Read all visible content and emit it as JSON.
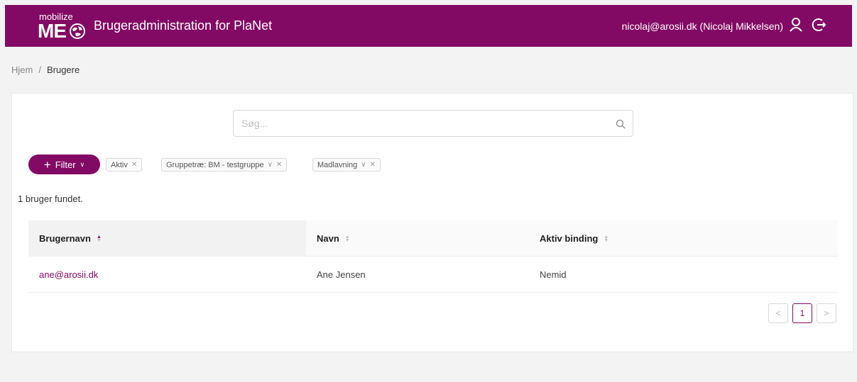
{
  "header": {
    "logo_small": "mobilize",
    "logo_big": "ME",
    "title": "Brugeradministration for PlaNet",
    "user": "nicolaj@arosii.dk (Nicolaj Mikkelsen)",
    "user_icon": "user-icon",
    "logout_icon": "logout-icon"
  },
  "breadcrumb": {
    "home": "Hjem",
    "separator": "/",
    "current": "Brugere"
  },
  "search": {
    "placeholder": "Søg...",
    "value": ""
  },
  "filters": {
    "button_label": "Filter",
    "tags": [
      {
        "label": "Aktiv"
      },
      {
        "label": "Gruppetræ: BM - testgruppe"
      },
      {
        "label": "Madlavning"
      }
    ]
  },
  "result_count": "1 bruger fundet.",
  "table": {
    "columns": [
      "Brugernavn",
      "Navn",
      "Aktiv binding"
    ],
    "rows": [
      [
        "ane@arosii.dk",
        "Ane Jensen",
        "Nemid"
      ]
    ]
  },
  "pagination": {
    "current": "1",
    "prev": "<",
    "next": ">"
  },
  "colors": {
    "brand": "#830a64"
  }
}
